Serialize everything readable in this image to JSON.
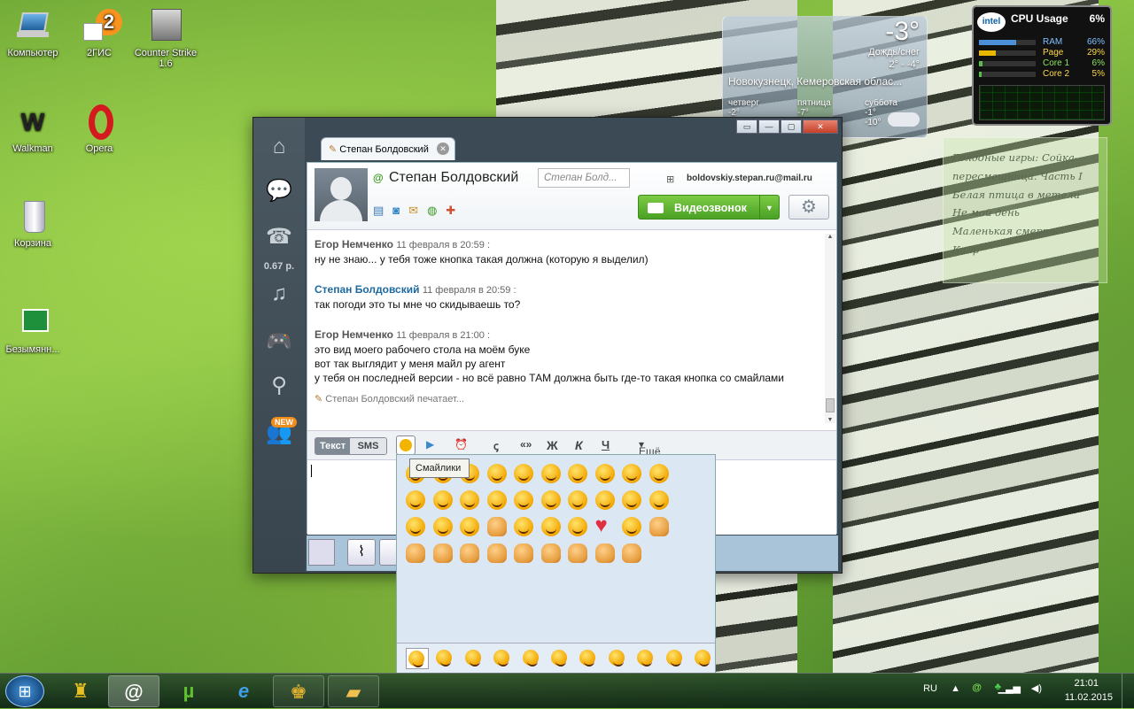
{
  "desktop": {
    "icons": [
      {
        "label": "Компьютер"
      },
      {
        "label": "2ГИС"
      },
      {
        "label": "Counter Strike 1.6"
      },
      {
        "label": "Walkman"
      },
      {
        "label": "Opera"
      },
      {
        "label": "Корзина"
      },
      {
        "label": "Безымянн..."
      }
    ]
  },
  "weather": {
    "temp": "-3°",
    "condition": "Дождь/снег",
    "range": "2° - -4°",
    "location": "Новокузнецк, Кемеровская облас...",
    "days": [
      {
        "name": "четверг",
        "t": "-2°"
      },
      {
        "name": "пятница",
        "t": "-7°"
      },
      {
        "name": "суббота",
        "t": "-1°",
        "low": "-10°"
      }
    ]
  },
  "cpu": {
    "brand": "intel",
    "title": "CPU Usage",
    "total": "6%",
    "rows": [
      {
        "label": "RAM",
        "value": "66%",
        "fill": 0.66
      },
      {
        "label": "Page",
        "value": "29%",
        "fill": 0.29
      },
      {
        "label": "Core 1",
        "value": "6%",
        "fill": 0.06
      },
      {
        "label": "Core 2",
        "value": "5%",
        "fill": 0.05
      }
    ]
  },
  "note": {
    "lines": [
      "Голодные игры: Сойка-",
      "пересмешница. Часть I",
      "Белая птица в метели",
      "Не мой день",
      "Маленькая смерть",
      "Кадр"
    ]
  },
  "agent": {
    "sidebar": {
      "balance": "0.67 р.",
      "new_badge": "NEW"
    },
    "tab_title": "Степан Болдовский",
    "contact": {
      "name": "Степан Болдовский",
      "status_placeholder": "Степан Болд...",
      "email": "boldovskiy.stepan.ru@mail.ru"
    },
    "video_button": "Видеозвонок",
    "messages": [
      {
        "author": "Егор Немченко",
        "date": "11 февраля в 20:59 :",
        "me": false,
        "lines": [
          "ну не знаю... у тебя тоже кнопка такая должна (которую я выделил)"
        ]
      },
      {
        "author": "Степан Болдовский",
        "date": "11 февраля в 20:59 :",
        "me": true,
        "lines": [
          "так погоди это ты мне чо скидываешь то?"
        ]
      },
      {
        "author": "Егор Немченко",
        "date": "11 февраля в 21:00 :",
        "me": false,
        "lines": [
          "это вид моего рабочего стола на моём буке",
          "вот так выглядит у меня майл ру агент",
          "у тебя он последней версии - но всё равно ТАМ должна быть где-то такая кнопка со смайлами"
        ]
      }
    ],
    "typing": "Степан Болдовский печатает...",
    "toolbar": {
      "text_tab": "Текст",
      "sms_tab": "SMS",
      "bold": "Ж",
      "italic": "К",
      "underline": "Ч",
      "quote": "«»",
      "more": "Ещё"
    },
    "tooltip": "Смайлики"
  },
  "taskbar": {
    "lang": "RU",
    "time": "21:01",
    "date": "11.02.2015"
  }
}
